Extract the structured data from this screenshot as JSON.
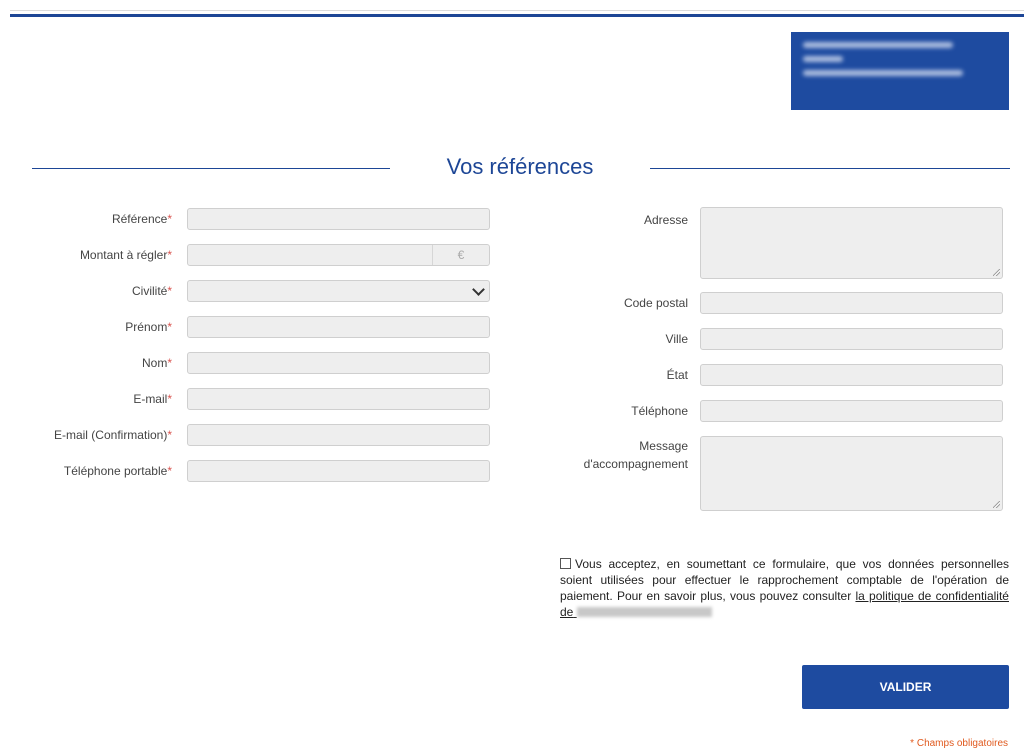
{
  "section_title": "Vos références",
  "left_fields": [
    {
      "label": "Référence",
      "required": "*"
    },
    {
      "label": "Montant à régler",
      "required": "*",
      "addon": "€"
    },
    {
      "label": "Civilité",
      "required": "*"
    },
    {
      "label": "Prénom",
      "required": "*"
    },
    {
      "label": "Nom",
      "required": "*"
    },
    {
      "label": "E-mail",
      "required": "*"
    },
    {
      "label": "E-mail (Confirmation)",
      "required": "*"
    },
    {
      "label": "Téléphone portable",
      "required": "*"
    }
  ],
  "right_fields": [
    {
      "label": "Adresse"
    },
    {
      "label": "Code postal"
    },
    {
      "label": "Ville"
    },
    {
      "label": "État"
    },
    {
      "label": "Téléphone"
    },
    {
      "label_line1": "Message",
      "label_line2": "d'accompagnement"
    }
  ],
  "consent": {
    "text": "Vous acceptez, en soumettant ce formulaire, que vos données personnelles soient utilisées pour effectuer le rapprochement comptable de l'opération de paiement. Pour en savoir plus, vous pouvez consulter ",
    "link_text": "la politique de confidentialité de"
  },
  "submit_label": "VALIDER",
  "footer_note": "* Champs obligatoires",
  "colors": {
    "brand": "#1d4696",
    "button": "#1e4ba0",
    "required": "#d9534f"
  }
}
